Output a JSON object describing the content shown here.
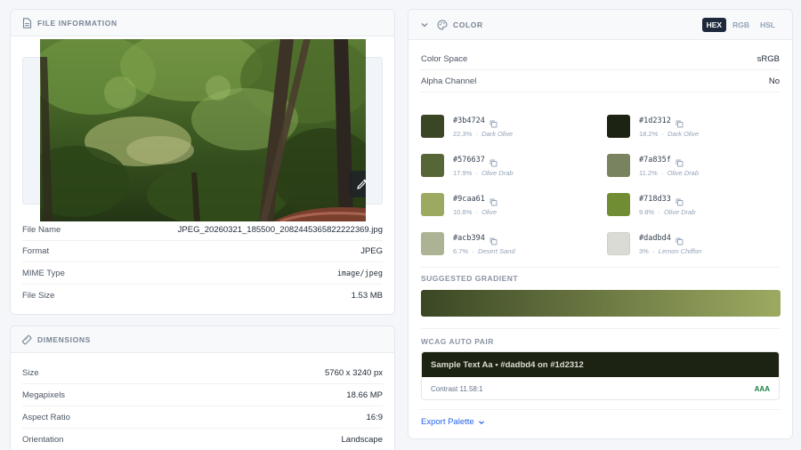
{
  "file_info": {
    "header": "FILE INFORMATION",
    "rows": [
      {
        "label": "File Name",
        "value": "JPEG_20260321_185500_2082445365822222369.jpg"
      },
      {
        "label": "Format",
        "value": "JPEG"
      },
      {
        "label": "MIME Type",
        "value": "image/jpeg"
      },
      {
        "label": "File Size",
        "value": "1.53 MB"
      }
    ]
  },
  "dimensions": {
    "header": "DIMENSIONS",
    "rows": [
      {
        "label": "Size",
        "value": "5760 x 3240 px"
      },
      {
        "label": "Megapixels",
        "value": "18.66 MP"
      },
      {
        "label": "Aspect Ratio",
        "value": "16:9"
      },
      {
        "label": "Orientation",
        "value": "Landscape"
      }
    ]
  },
  "color": {
    "header": "COLOR",
    "formats": [
      "HEX",
      "RGB",
      "HSL"
    ],
    "active_format": "HEX",
    "rows": [
      {
        "label": "Color Space",
        "value": "sRGB"
      },
      {
        "label": "Alpha Channel",
        "value": "No"
      }
    ],
    "swatches": [
      {
        "hex": "#3b4724",
        "pct": "22.3%",
        "name": "Dark Olive"
      },
      {
        "hex": "#1d2312",
        "pct": "18.2%",
        "name": "Dark Olive"
      },
      {
        "hex": "#576637",
        "pct": "17.9%",
        "name": "Olive Drab"
      },
      {
        "hex": "#7a835f",
        "pct": "11.2%",
        "name": "Olive Drab"
      },
      {
        "hex": "#9caa61",
        "pct": "10.8%",
        "name": "Olive"
      },
      {
        "hex": "#718d33",
        "pct": "9.8%",
        "name": "Olive Drab"
      },
      {
        "hex": "#acb394",
        "pct": "6.7%",
        "name": "Desert Sand"
      },
      {
        "hex": "#dadbd4",
        "pct": "3%",
        "name": "Lemon Chiffon"
      }
    ],
    "gradient_label": "SUGGESTED GRADIENT",
    "gradient_colors": [
      "#3b4724",
      "#9caa61"
    ],
    "wcag_label": "WCAG AUTO PAIR",
    "wcag_sample": "Sample Text Aa • #dadbd4 on #1d2312",
    "wcag_fg": "#dadbd4",
    "wcag_bg": "#1d2312",
    "wcag_contrast": "Contrast 11.58:1",
    "wcag_level": "AAA",
    "export_label": "Export Palette"
  },
  "colors": {
    "accent": "#2563eb",
    "pass": "#15803d"
  }
}
